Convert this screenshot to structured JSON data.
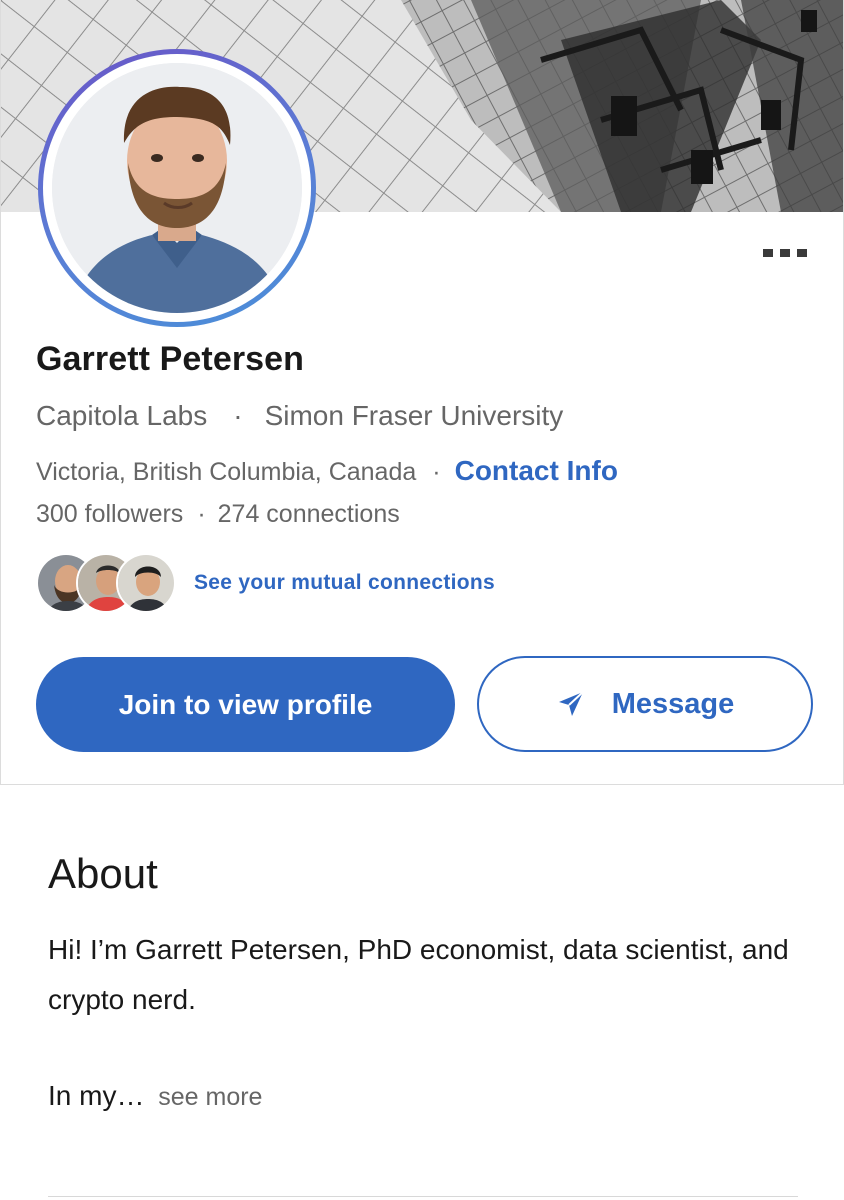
{
  "profile": {
    "name": "Garrett Petersen",
    "company": "Capitola Labs",
    "school": "Simon Fraser University",
    "location": "Victoria, British Columbia, Canada",
    "contact_info_label": "Contact Info",
    "followers": "300 followers",
    "connections": "274 connections",
    "separator": "·",
    "mutual_connections_label": "See your mutual connections"
  },
  "actions": {
    "join_label": "Join to view profile",
    "message_label": "Message",
    "more_icon": "more-horizontal-icon",
    "message_icon": "send-icon"
  },
  "about": {
    "title": "About",
    "text": "Hi! I’m Garrett Petersen, PhD economist, data scientist, and crypto nerd.",
    "truncated_text": "In my…",
    "see_more_label": "see more"
  },
  "colors": {
    "accent": "#2f67c1",
    "secondary_text": "#666666",
    "primary_text": "#191919",
    "avatar_ring_start": "#6a55c7",
    "avatar_ring_end": "#4a8fd8"
  }
}
